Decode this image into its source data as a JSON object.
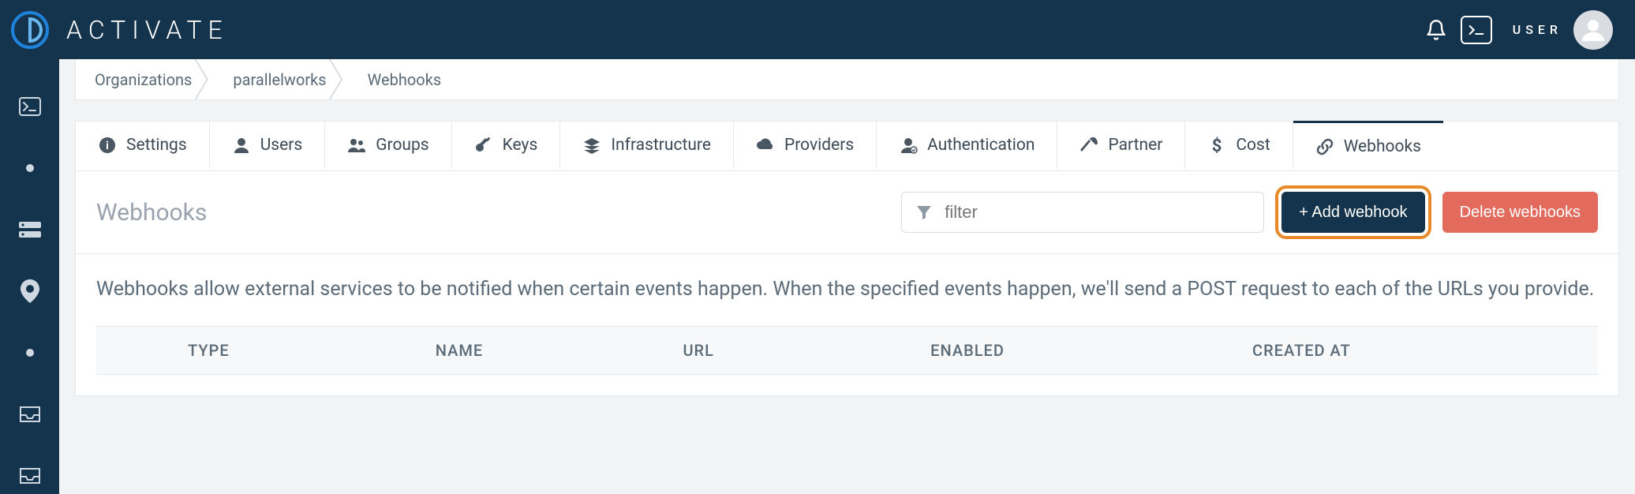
{
  "brand": {
    "name": "ACTIVATE",
    "user_label": "USER"
  },
  "breadcrumbs": [
    "Organizations",
    "parallelworks",
    "Webhooks"
  ],
  "tabs": [
    {
      "id": "settings",
      "label": "Settings"
    },
    {
      "id": "users",
      "label": "Users"
    },
    {
      "id": "groups",
      "label": "Groups"
    },
    {
      "id": "keys",
      "label": "Keys"
    },
    {
      "id": "infrastructure",
      "label": "Infrastructure"
    },
    {
      "id": "providers",
      "label": "Providers"
    },
    {
      "id": "authentication",
      "label": "Authentication"
    },
    {
      "id": "partner",
      "label": "Partner"
    },
    {
      "id": "cost",
      "label": "Cost"
    },
    {
      "id": "webhooks",
      "label": "Webhooks",
      "active": true
    }
  ],
  "section": {
    "title": "Webhooks",
    "filter_placeholder": "filter",
    "add_button": "+ Add webhook",
    "delete_button": "Delete webhooks",
    "description": "Webhooks allow external services to be notified when certain events happen. When the specified events happen, we'll send a POST request to each of the URLs you provide."
  },
  "table": {
    "columns": [
      "TYPE",
      "NAME",
      "URL",
      "ENABLED",
      "CREATED AT"
    ],
    "rows": []
  }
}
